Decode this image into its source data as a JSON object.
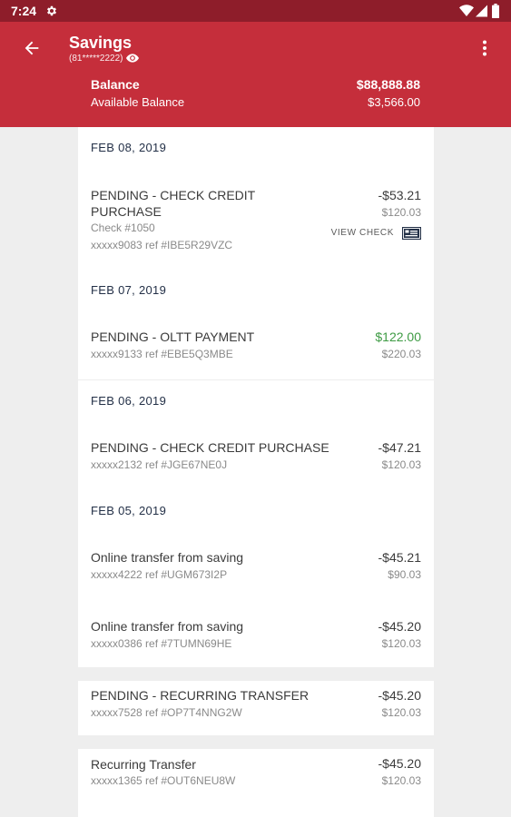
{
  "status": {
    "time": "7:24"
  },
  "header": {
    "title": "Savings",
    "account_mask": "(81*****2222)",
    "balance_label": "Balance",
    "balance_value": "$88,888.88",
    "available_label": "Available Balance",
    "available_value": "$3,566.00"
  },
  "groups": [
    {
      "date": "FEB 08, 2019"
    },
    {
      "date": "FEB 07, 2019"
    },
    {
      "date": "FEB 06, 2019"
    },
    {
      "date": "FEB 05, 2019"
    }
  ],
  "transactions": [
    {
      "name_line1": "PENDING - CHECK CREDIT",
      "name_line2": "PURCHASE",
      "check": "Check #1050",
      "ref": "xxxxx9083 ref #IBE5R29VZC",
      "amount": "-$53.21",
      "running": "$120.03",
      "view_check": "VIEW CHECK"
    },
    {
      "name": "PENDING - OLTT PAYMENT",
      "ref": "xxxxx9133 ref #EBE5Q3MBE",
      "amount": "$122.00",
      "running": "$220.03"
    },
    {
      "name": "PENDING - CHECK CREDIT PURCHASE",
      "ref": "xxxxx2132 ref #JGE67NE0J",
      "amount": "-$47.21",
      "running": "$120.03"
    },
    {
      "name": "Online transfer from saving",
      "ref": "xxxxx4222 ref #UGM673I2P",
      "amount": "-$45.21",
      "running": "$90.03"
    },
    {
      "name": "Online transfer from saving",
      "ref": "xxxxx0386 ref #7TUMN69HE",
      "amount": "-$45.20",
      "running": "$120.03"
    },
    {
      "name": "PENDING - RECURRING TRANSFER",
      "ref": "xxxxx7528 ref #OP7T4NNG2W",
      "amount": "-$45.20",
      "running": "$120.03"
    },
    {
      "name": "Recurring Transfer",
      "ref": "xxxxx1365 ref #OUT6NEU8W",
      "amount": "-$45.20",
      "running": "$120.03"
    }
  ],
  "colors": {
    "brand_red": "#c52e3b",
    "status_bar": "#8e1d2a",
    "positive_green": "#3e9b44"
  },
  "icons": [
    "settings-icon",
    "wifi-icon",
    "cellular-icon",
    "battery-icon",
    "back-arrow-icon",
    "eye-icon",
    "more-vert-icon",
    "check-image-icon"
  ]
}
